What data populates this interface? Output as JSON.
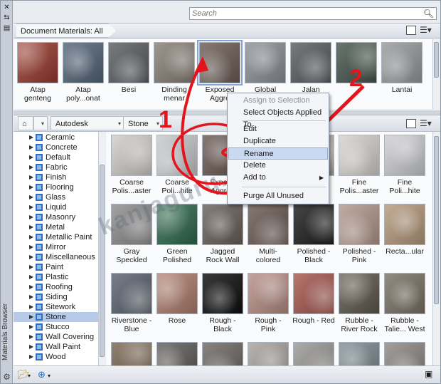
{
  "app": {
    "title": "Materials Browser"
  },
  "search": {
    "placeholder": "Search"
  },
  "document_materials": {
    "header": "Document Materials: All",
    "items": [
      {
        "label": "Atap genteng",
        "color": "#9a3b2e"
      },
      {
        "label": "Atap poly...onat",
        "color": "#56677a"
      },
      {
        "label": "Besi",
        "color": "#5c5f63"
      },
      {
        "label": "Dinding menar",
        "color": "#8a8178"
      },
      {
        "label": "Exposed Aggre",
        "color": "#6d5e57"
      },
      {
        "label": "Global",
        "color": "#8e9399"
      },
      {
        "label": "Jalan",
        "color": "#5b5e62"
      },
      {
        "label": "",
        "color": "#47574e"
      },
      {
        "label": "Lantai",
        "color": "#9a9c9e"
      }
    ]
  },
  "library": {
    "breadcrumb": [
      "Autodesk Library",
      "Stone"
    ],
    "categories": [
      "Ceramic",
      "Concrete",
      "Default",
      "Fabric",
      "Finish",
      "Flooring",
      "Glass",
      "Liquid",
      "Masonry",
      "Metal",
      "Metallic Paint",
      "Mirror",
      "Miscellaneous",
      "Paint",
      "Plastic",
      "Roofing",
      "Siding",
      "Sitework",
      "Stone",
      "Stucco",
      "Wall Covering",
      "Wall Paint",
      "Wood"
    ],
    "selected_category": "Stone",
    "materials": [
      {
        "label": "Coarse Polis...aster",
        "color": "#d2cfca"
      },
      {
        "label": "Coarse Poli...hite",
        "color": "#c9cbcd"
      },
      {
        "label": "Expose Aggreg",
        "color": "#6b5b55"
      },
      {
        "label": "",
        "color": "#9c8d80"
      },
      {
        "label": "",
        "color": "#b7b3ac"
      },
      {
        "label": "Fine Polis...aster",
        "color": "#d8d5d0"
      },
      {
        "label": "Fine Poli...hite",
        "color": "#cfd0d2"
      },
      {
        "label": "Gray Speckled",
        "color": "#8f8f8f"
      },
      {
        "label": "Green Polished",
        "color": "#2f6a4c"
      },
      {
        "label": "Jagged Rock Wall",
        "color": "#6a625b"
      },
      {
        "label": "Multi-colored",
        "color": "#6b5c56"
      },
      {
        "label": "Polished - Black",
        "color": "#1e1e1e"
      },
      {
        "label": "Polished - Pink",
        "color": "#b49a8e"
      },
      {
        "label": "Recta...ular",
        "color": "#b79b7f"
      },
      {
        "label": "Riverstone - Blue",
        "color": "#5c6470"
      },
      {
        "label": "Rose",
        "color": "#b07f6f"
      },
      {
        "label": "Rough - Black",
        "color": "#0f0f0f"
      },
      {
        "label": "Rough - Pink",
        "color": "#b99087"
      },
      {
        "label": "Rough - Red",
        "color": "#a85850"
      },
      {
        "label": "Rubble - River Rock",
        "color": "#615a4e"
      },
      {
        "label": "Rubble - Talie... West",
        "color": "#7c7466"
      },
      {
        "label": "",
        "color": "#7a6652"
      },
      {
        "label": "",
        "color": "#5f5d5b"
      },
      {
        "label": "",
        "color": "#6e6a66"
      },
      {
        "label": "",
        "color": "#a9a4a0"
      },
      {
        "label": "",
        "color": "#9b9a98"
      },
      {
        "label": "",
        "color": "#7d8a90"
      },
      {
        "label": "",
        "color": "#8f8a86"
      }
    ]
  },
  "context_menu": {
    "items": [
      {
        "label": "Assign to Selection",
        "disabled": true
      },
      {
        "label": "Select Objects Applied To",
        "disabled": false
      },
      {
        "label": "Edit",
        "disabled": false
      },
      {
        "label": "Duplicate",
        "disabled": false
      },
      {
        "label": "Rename",
        "disabled": false,
        "highlighted": true
      },
      {
        "label": "Delete",
        "disabled": false
      },
      {
        "label": "Add to",
        "disabled": false,
        "submenu": true
      },
      {
        "label": "Purge All Unused",
        "disabled": false
      }
    ]
  },
  "annotations": {
    "step1": "1",
    "step2": "2",
    "watermark": "kanjaguru.com"
  },
  "colors": {
    "highlight": "#c9d9f1",
    "selection": "#b7cbe8",
    "annotation": "#e3141c"
  }
}
